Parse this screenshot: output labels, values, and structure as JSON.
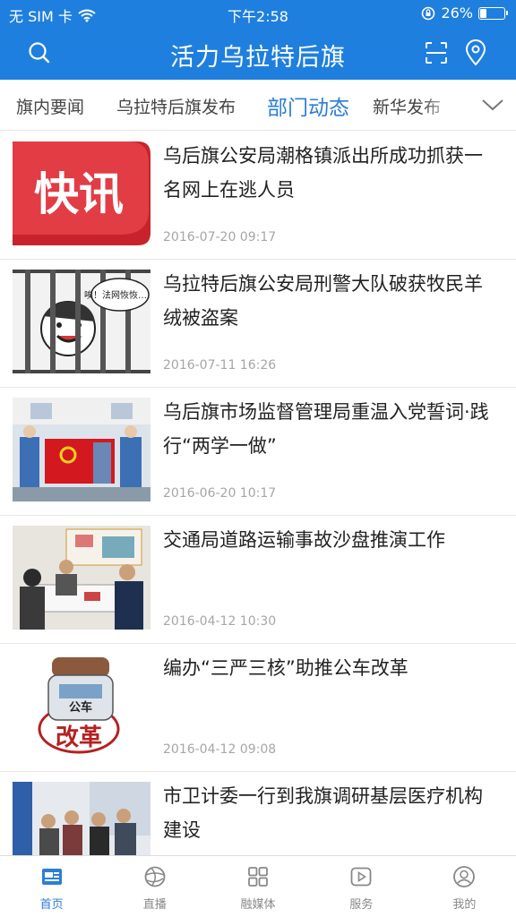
{
  "status_bar": {
    "carrier": "无 SIM 卡",
    "time": "下午2:58",
    "battery": "26%",
    "battery_level": 0.26
  },
  "header": {
    "title": "活力乌拉特后旗"
  },
  "tabs": [
    {
      "label": "旗内要闻"
    },
    {
      "label": "乌拉特后旗发布"
    },
    {
      "label": "部门动态"
    },
    {
      "label": "新华发布"
    }
  ],
  "articles": [
    {
      "title": "乌后旗公安局潮格镇派出所成功抓获一名网上在逃人员",
      "date": "2016-07-20 09:17",
      "thumb_text": "快讯"
    },
    {
      "title": "乌拉特后旗公安局刑警大队破获牧民羊绒被盗案",
      "date": "2016-07-11 16:26",
      "thumb_text": "唉！法网恢恢……"
    },
    {
      "title": "乌后旗市场监督管理局重温入党誓词·践行“两学一做”",
      "date": "2016-06-20 10:17"
    },
    {
      "title": "交通局道路运输事故沙盘推演工作",
      "date": "2016-04-12 10:30"
    },
    {
      "title": "编办“三严三核”助推公车改革",
      "date": "2016-04-12 09:08",
      "thumb_text": [
        "公车",
        "改革"
      ]
    },
    {
      "title": "市卫计委一行到我旗调研基层医疗机构建设",
      "date": ""
    }
  ],
  "bottom_nav": [
    {
      "label": "首页",
      "icon": "home-news-icon"
    },
    {
      "label": "直播",
      "icon": "globe-icon"
    },
    {
      "label": "融媒体",
      "icon": "grid-icon"
    },
    {
      "label": "服务",
      "icon": "play-icon"
    },
    {
      "label": "我的",
      "icon": "user-icon"
    }
  ],
  "colors": {
    "brand": "#1f7fde",
    "active_tab": "#2b7ed6",
    "date": "#a6a6a6"
  }
}
